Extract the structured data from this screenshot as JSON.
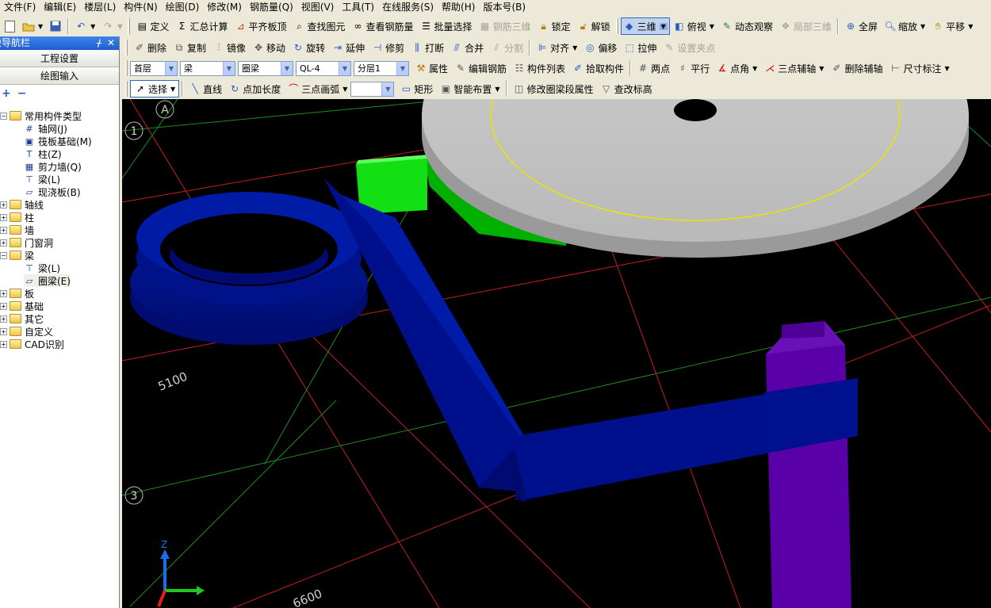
{
  "menu": [
    "文件(F)",
    "编辑(E)",
    "楼层(L)",
    "构件(N)",
    "绘图(D)",
    "修改(M)",
    "钢筋量(Q)",
    "视图(V)",
    "工具(T)",
    "在线服务(S)",
    "帮助(H)",
    "版本号(B)"
  ],
  "toolbar1": {
    "define": "定义",
    "summary_calc": "汇总计算",
    "level_slab_top": "平齐板顶",
    "find_element": "查找图元",
    "view_rebar_qty": "查看钢筋量",
    "batch_select": "批量选择",
    "rebar_3d": "钢筋三维",
    "lock": "锁定",
    "unlock": "解锁",
    "view3d": "三维",
    "top_view": "俯视",
    "dynamic_observe": "动态观察",
    "local_3d": "局部三维",
    "fullscreen": "全屏",
    "zoom": "缩放",
    "pan": "平移"
  },
  "toolbar2": {
    "delete": "删除",
    "copy": "复制",
    "mirror": "镜像",
    "move": "移动",
    "rotate": "旋转",
    "extend": "延伸",
    "trim": "修剪",
    "break": "打断",
    "merge": "合并",
    "split": "分割",
    "align": "对齐",
    "offset": "偏移",
    "stretch": "拉伸",
    "set_grip": "设置夹点"
  },
  "toolbar3": {
    "floor": "首层",
    "category": "梁",
    "type": "圈梁",
    "name": "QL-4",
    "layer": "分层1",
    "properties": "属性",
    "edit_rebar": "编辑钢筋",
    "component_list": "构件列表",
    "pick_component": "拾取构件",
    "two_points": "两点",
    "parallel": "平行",
    "point_angle": "点角",
    "three_point_aux": "三点辅轴",
    "delete_aux": "删除辅轴",
    "dimension": "尺寸标注"
  },
  "toolbar4": {
    "select": "选择",
    "line": "直线",
    "point_length": "点加长度",
    "three_point_arc": "三点画弧",
    "rectangle": "矩形",
    "smart_layout": "智能布置",
    "modify_segment": "修改圈梁段属性",
    "check_elevation": "查改标高"
  },
  "nav": {
    "title": "模块导航栏",
    "btn_project_settings": "工程设置",
    "btn_drawing_input": "绘图输入",
    "tree": [
      {
        "label": "常用构件类型",
        "kind": "folder",
        "expanded": true,
        "level": 0
      },
      {
        "label": "轴网(J)",
        "kind": "item",
        "icon": "axis-grid-icon",
        "level": 1
      },
      {
        "label": "筏板基础(M)",
        "kind": "item",
        "icon": "raft-foundation-icon",
        "level": 1
      },
      {
        "label": "柱(Z)",
        "kind": "item",
        "icon": "column-icon",
        "level": 1
      },
      {
        "label": "剪力墙(Q)",
        "kind": "item",
        "icon": "shear-wall-icon",
        "level": 1
      },
      {
        "label": "梁(L)",
        "kind": "item",
        "icon": "beam-icon",
        "level": 1
      },
      {
        "label": "现浇板(B)",
        "kind": "item",
        "icon": "slab-icon",
        "level": 1
      },
      {
        "label": "轴线",
        "kind": "folder",
        "expanded": false,
        "level": 0
      },
      {
        "label": "柱",
        "kind": "folder",
        "expanded": false,
        "level": 0
      },
      {
        "label": "墙",
        "kind": "folder",
        "expanded": false,
        "level": 0
      },
      {
        "label": "门窗洞",
        "kind": "folder",
        "expanded": false,
        "level": 0
      },
      {
        "label": "梁",
        "kind": "folder",
        "expanded": true,
        "level": 0
      },
      {
        "label": "梁(L)",
        "kind": "item",
        "icon": "beam-icon",
        "level": 1
      },
      {
        "label": "圈梁(E)",
        "kind": "item",
        "icon": "ring-beam-icon",
        "level": 1,
        "selected": true
      },
      {
        "label": "板",
        "kind": "folder",
        "expanded": false,
        "level": 0
      },
      {
        "label": "基础",
        "kind": "folder",
        "expanded": false,
        "level": 0
      },
      {
        "label": "其它",
        "kind": "folder",
        "expanded": false,
        "level": 0
      },
      {
        "label": "自定义",
        "kind": "folder",
        "expanded": false,
        "level": 0
      },
      {
        "label": "CAD识别",
        "kind": "folder",
        "expanded": false,
        "level": 0
      }
    ]
  },
  "viewport": {
    "axis_labels": [
      "A",
      "1",
      "3"
    ],
    "dimensions": [
      "5100",
      "6600"
    ],
    "axis_triad_label": "Z",
    "colors": {
      "background": "#000000",
      "ring_beam": "#000f8c",
      "slab": "#c8c8c8",
      "green_beam": "#00d800",
      "column": "#5a00a8",
      "grid_red": "#c81e1e",
      "grid_green": "#1e8c1e"
    }
  }
}
